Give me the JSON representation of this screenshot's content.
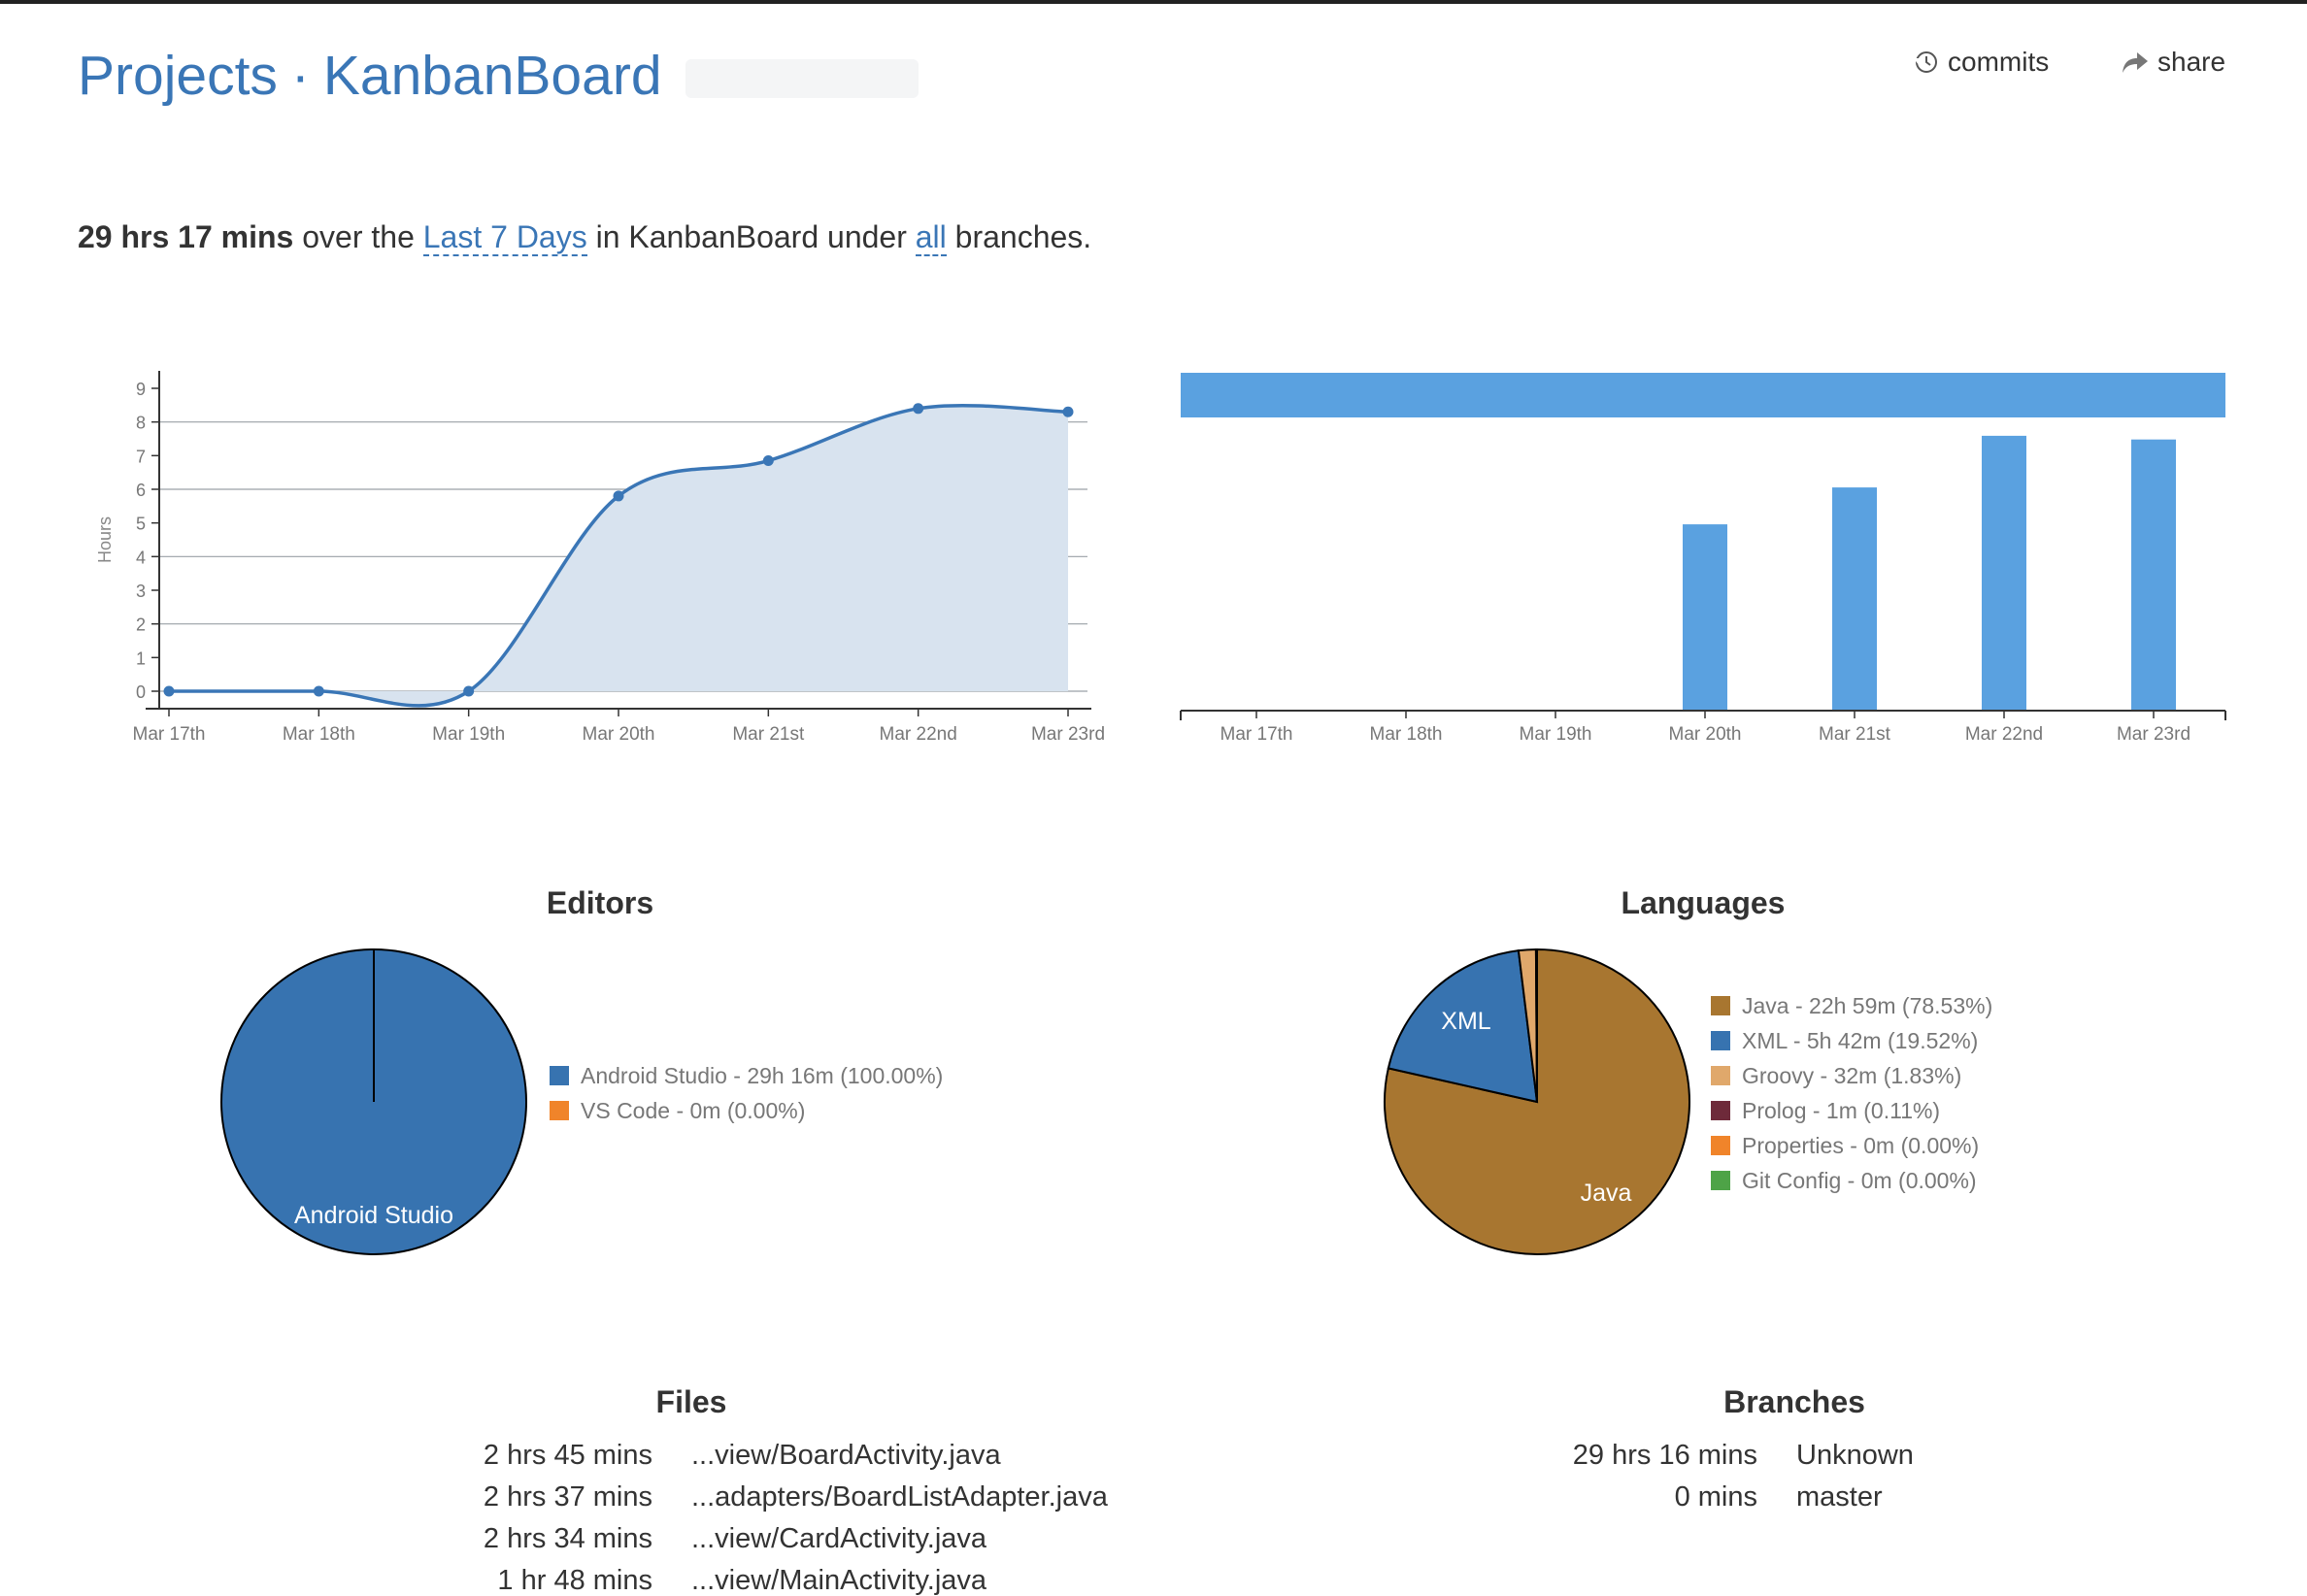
{
  "header": {
    "breadcrumb_root": "Projects",
    "breadcrumb_sep": "·",
    "project_name": "KanbanBoard",
    "commits_label": "commits",
    "share_label": "share"
  },
  "summary": {
    "total": "29 hrs 17 mins",
    "text1": " over the ",
    "range": "Last 7 Days",
    "text2": " in KanbanBoard under ",
    "branches_link": "all",
    "text3": " branches."
  },
  "colors": {
    "link": "#3a76b6",
    "line": "#3a76b6",
    "area": "#d8e3ef",
    "bar": "#5aa1e0",
    "android_studio": "#3773b0",
    "vscode": "#f0842a",
    "java": "#a87630",
    "xml": "#3773b0",
    "groovy": "#e0a86b",
    "prolog": "#6e2a3a",
    "properties": "#f0842a",
    "git_config": "#4ea347"
  },
  "chart_data": [
    {
      "type": "area",
      "ylabel": "Hours",
      "categories": [
        "Mar 17th",
        "Mar 18th",
        "Mar 19th",
        "Mar 20th",
        "Mar 21st",
        "Mar 22nd",
        "Mar 23rd"
      ],
      "values": [
        0,
        0,
        0,
        5.8,
        6.85,
        8.4,
        8.3
      ],
      "yticks": [
        0,
        1,
        2,
        3,
        4,
        5,
        6,
        7,
        8,
        9
      ],
      "ylim": [
        0,
        9
      ],
      "grid": true
    },
    {
      "type": "bar",
      "categories": [
        "Mar 17th",
        "Mar 18th",
        "Mar 19th",
        "Mar 20th",
        "Mar 21st",
        "Mar 22nd",
        "Mar 23rd"
      ],
      "values": [
        0,
        0,
        0,
        5.05,
        6.05,
        7.45,
        7.35
      ],
      "ylim": [
        0,
        9
      ],
      "grid": false
    },
    {
      "type": "pie",
      "title": "Editors",
      "slices": [
        {
          "name": "Android Studio",
          "label": "Android Studio - 29h 16m (100.00%)",
          "value": 100.0,
          "color": "#3773b0",
          "pie_label": "Android Studio"
        },
        {
          "name": "VS Code",
          "label": "VS Code - 0m (0.00%)",
          "value": 0.0,
          "color": "#f0842a",
          "pie_label": ""
        }
      ]
    },
    {
      "type": "pie",
      "title": "Languages",
      "slices": [
        {
          "name": "Java",
          "label": "Java - 22h 59m (78.53%)",
          "value": 78.53,
          "color": "#a87630",
          "pie_label": "Java"
        },
        {
          "name": "XML",
          "label": "XML - 5h 42m (19.52%)",
          "value": 19.52,
          "color": "#3773b0",
          "pie_label": "XML"
        },
        {
          "name": "Groovy",
          "label": "Groovy - 32m (1.83%)",
          "value": 1.83,
          "color": "#e0a86b",
          "pie_label": ""
        },
        {
          "name": "Prolog",
          "label": "Prolog - 1m (0.11%)",
          "value": 0.11,
          "color": "#6e2a3a",
          "pie_label": ""
        },
        {
          "name": "Properties",
          "label": "Properties - 0m (0.00%)",
          "value": 0.0,
          "color": "#f0842a",
          "pie_label": ""
        },
        {
          "name": "Git Config",
          "label": "Git Config - 0m (0.00%)",
          "value": 0.0,
          "color": "#4ea347",
          "pie_label": ""
        }
      ]
    }
  ],
  "files": {
    "title": "Files",
    "rows": [
      {
        "time": "2 hrs 45 mins",
        "name": "...view/BoardActivity.java"
      },
      {
        "time": "2 hrs 37 mins",
        "name": "...adapters/BoardListAdapter.java"
      },
      {
        "time": "2 hrs 34 mins",
        "name": "...view/CardActivity.java"
      },
      {
        "time": "1 hr 48 mins",
        "name": "...view/MainActivity.java"
      }
    ]
  },
  "branches": {
    "title": "Branches",
    "rows": [
      {
        "time": "29 hrs 16 mins",
        "name": "Unknown"
      },
      {
        "time": "0 mins",
        "name": "master"
      }
    ]
  }
}
